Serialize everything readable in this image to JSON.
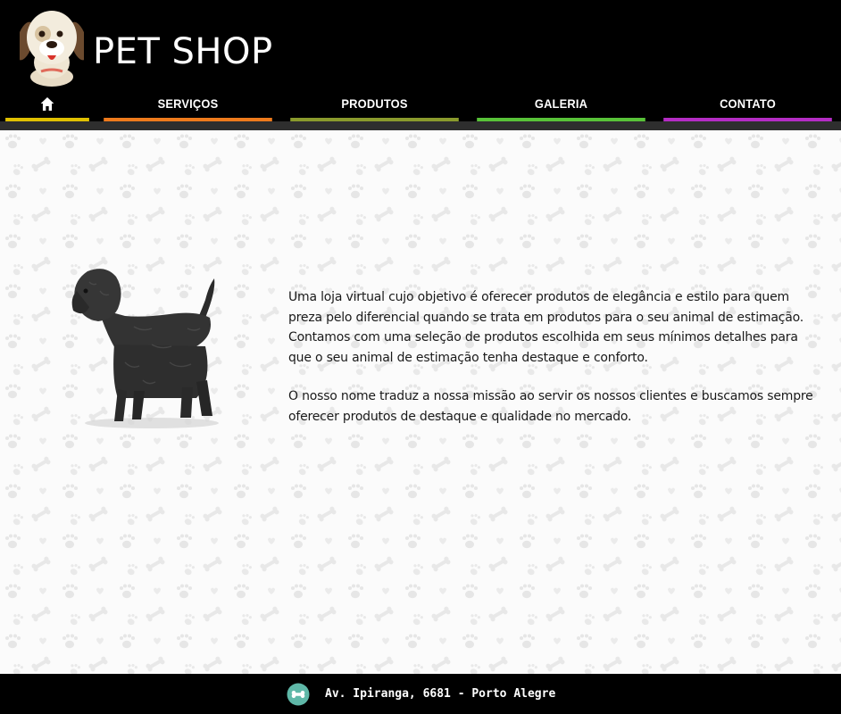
{
  "header": {
    "title": "PET SHOP",
    "logo_icon": "cartoon-dog-logo-icon"
  },
  "nav": {
    "items": [
      {
        "key": "home",
        "label": "",
        "icon": "home-icon",
        "color": "#e0c000"
      },
      {
        "key": "servicos",
        "label": "SERVIÇOS",
        "color": "#ee7a1c"
      },
      {
        "key": "produtos",
        "label": "PRODUTOS",
        "color": "#8a9a2c"
      },
      {
        "key": "galeria",
        "label": "GALERIA",
        "color": "#58c238"
      },
      {
        "key": "contato",
        "label": "CONTATO",
        "color": "#b42cc4"
      }
    ]
  },
  "main": {
    "image": "black-dog-photo",
    "paragraphs": [
      "Uma loja virtual cujo objetivo é oferecer produtos de elegância e estilo para quem preza pelo diferencial quando se trata em produtos para o seu animal de estimação. Contamos com uma seleção de produtos escolhida em seus mínimos detalhes para que o seu animal de estimação tenha destaque e conforto.",
      "O nosso nome traduz a nossa missão ao servir os nossos clientes e buscamos sempre oferecer produtos de destaque e qualidade no mercado."
    ]
  },
  "footer": {
    "icon": "bone-icon",
    "address": "Av. Ipiranga, 6681 - Porto Alegre"
  }
}
